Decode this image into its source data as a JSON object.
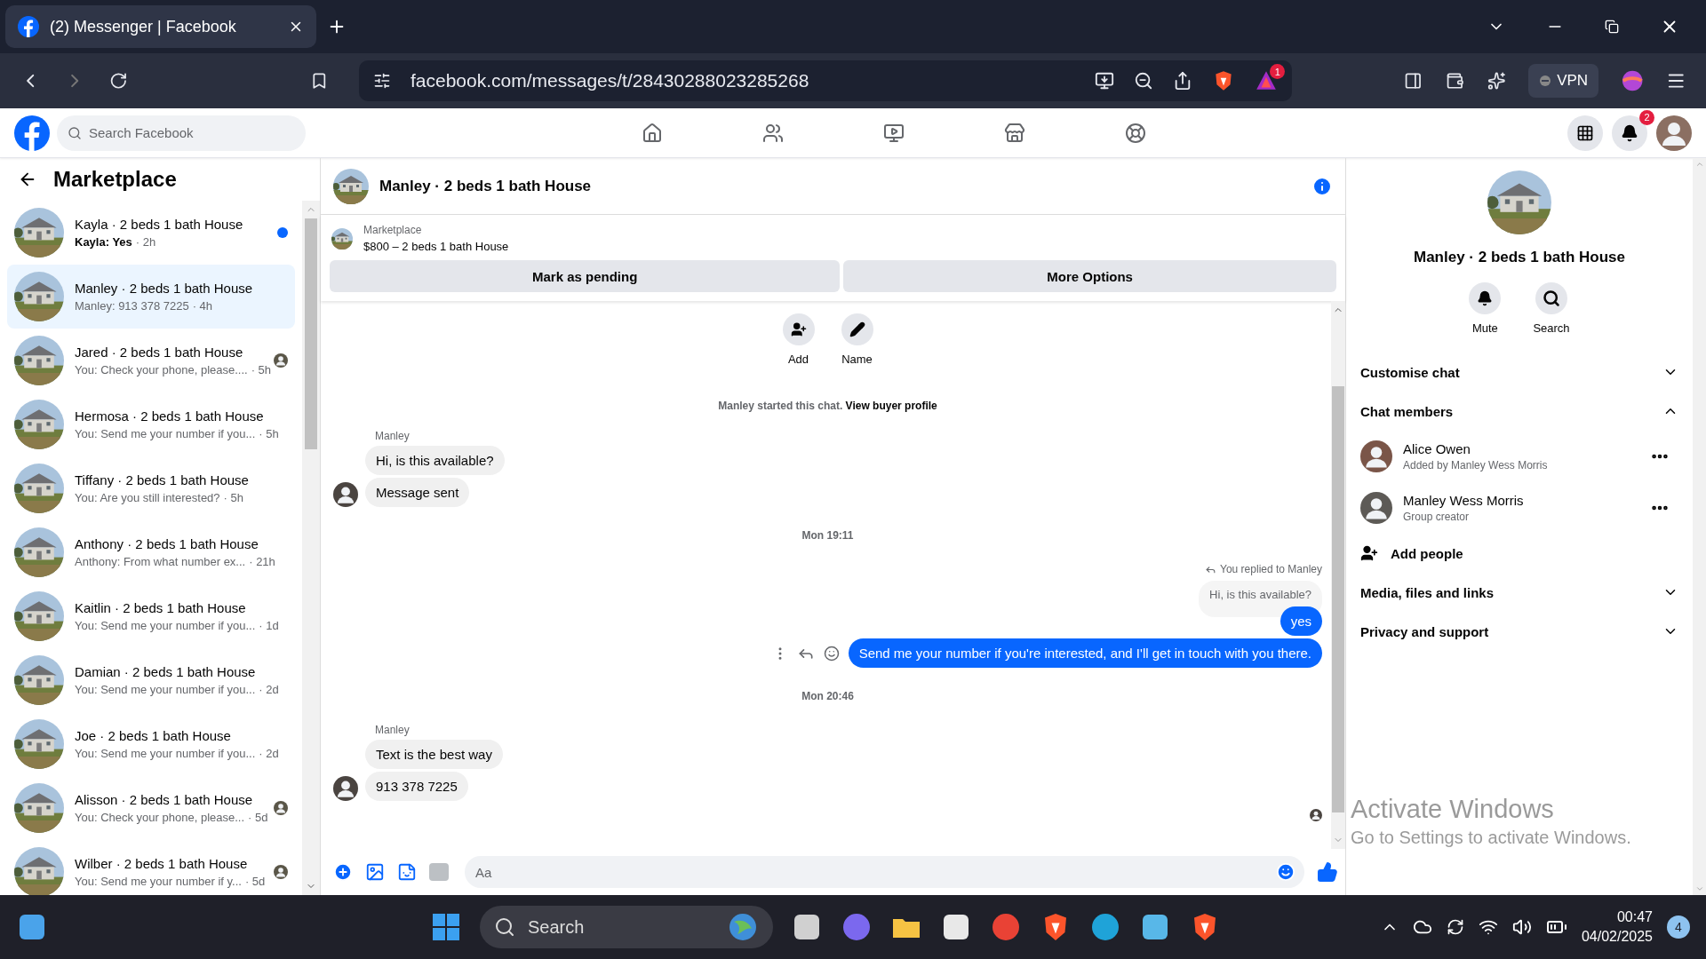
{
  "browser": {
    "tab_title": "(2) Messenger | Facebook",
    "url": "facebook.com/messages/t/28430288023285268",
    "alert_count": "1",
    "vpn_label": "VPN"
  },
  "facebook_header": {
    "search_placeholder": "Search Facebook",
    "notification_count": "2"
  },
  "sidebar": {
    "title": "Marketplace",
    "conversations": [
      {
        "name": "Kayla · 2 beds 1 bath House",
        "preview": "Kayla: Yes",
        "time": "· 2h",
        "selected": false,
        "unread": true,
        "seen": false
      },
      {
        "name": "Manley · 2 beds 1 bath House",
        "preview": "Manley: 913 378 7225",
        "time": "· 4h",
        "selected": true,
        "unread": false,
        "seen": false
      },
      {
        "name": "Jared · 2 beds 1 bath House",
        "preview": "You: Check your phone, please....",
        "time": "· 5h",
        "selected": false,
        "unread": false,
        "seen": true
      },
      {
        "name": "Hermosa · 2 beds 1 bath House",
        "preview": "You: Send me your number if you...",
        "time": "· 5h",
        "selected": false,
        "unread": false,
        "seen": false
      },
      {
        "name": "Tiffany · 2 beds 1 bath House",
        "preview": "You: Are you still interested?",
        "time": "· 5h",
        "selected": false,
        "unread": false,
        "seen": false
      },
      {
        "name": "Anthony · 2 beds 1 bath House",
        "preview": "Anthony: From what number ex...",
        "time": "· 21h",
        "selected": false,
        "unread": false,
        "seen": false
      },
      {
        "name": "Kaitlin · 2 beds 1 bath House",
        "preview": "You: Send me your number if you...",
        "time": "· 1d",
        "selected": false,
        "unread": false,
        "seen": false
      },
      {
        "name": "Damian · 2 beds 1 bath House",
        "preview": "You: Send me your number if you...",
        "time": "· 2d",
        "selected": false,
        "unread": false,
        "seen": false
      },
      {
        "name": "Joe · 2 beds 1 bath House",
        "preview": "You: Send me your number if you...",
        "time": "· 2d",
        "selected": false,
        "unread": false,
        "seen": false
      },
      {
        "name": "Alisson · 2 beds 1 bath House",
        "preview": "You: Check your phone, please...",
        "time": "· 5d",
        "selected": false,
        "unread": false,
        "seen": true
      },
      {
        "name": "Wilber · 2 beds 1 bath House",
        "preview": "You: Send me your number if y...",
        "time": "· 5d",
        "selected": false,
        "unread": false,
        "seen": true
      }
    ]
  },
  "chat": {
    "title": "Manley · 2 beds 1 bath House",
    "listing": {
      "label": "Marketplace",
      "title": "$800 – 2 beds 1 bath House"
    },
    "buttons": [
      "Mark as pending",
      "More Options"
    ],
    "actions": [
      {
        "kind": "add",
        "label": "Add"
      },
      {
        "kind": "name",
        "label": "Name"
      }
    ],
    "started": {
      "text": "Manley started this chat.",
      "link": "View buyer profile"
    },
    "messages": [
      {
        "kind": "sender",
        "text": "Manley"
      },
      {
        "kind": "incoming",
        "text": "Hi, is this available?",
        "avatar": false
      },
      {
        "kind": "incoming",
        "text": "Message sent",
        "avatar": true
      },
      {
        "kind": "time",
        "text": "Mon 19:11"
      },
      {
        "kind": "reply-note",
        "text": "You replied to Manley"
      },
      {
        "kind": "quoted",
        "text": "Hi, is this available?"
      },
      {
        "kind": "outgoing",
        "text": "yes",
        "tools": false
      },
      {
        "kind": "outgoing",
        "text": "Send me your number if you're interested, and I'll get in touch with you there.",
        "tools": true
      },
      {
        "kind": "time",
        "text": "Mon 20:46"
      },
      {
        "kind": "sender",
        "text": "Manley"
      },
      {
        "kind": "incoming",
        "text": "Text is the best way",
        "avatar": false
      },
      {
        "kind": "incoming",
        "text": "913 378 7225",
        "avatar": true
      },
      {
        "kind": "seen"
      }
    ],
    "composer": {
      "placeholder": "Aa"
    }
  },
  "details": {
    "title": "Manley · 2 beds 1 bath House",
    "actions": [
      {
        "kind": "mute",
        "label": "Mute"
      },
      {
        "kind": "search",
        "label": "Search"
      }
    ],
    "sections": [
      {
        "label": "Customise chat",
        "expanded": false
      },
      {
        "label": "Chat members",
        "expanded": true,
        "members": [
          {
            "name": "Alice Owen",
            "role": "Added by Manley Wess Morris"
          },
          {
            "name": "Manley Wess Morris",
            "role": "Group creator"
          }
        ],
        "add_label": "Add people"
      },
      {
        "label": "Media, files and links",
        "expanded": false
      },
      {
        "label": "Privacy and support",
        "expanded": false
      }
    ]
  },
  "taskbar": {
    "search": "Search",
    "time": "00:47",
    "date": "04/02/2025",
    "notification_count": "4"
  },
  "os_notice": {
    "title": "Activate Windows",
    "text": "Go to Settings to activate Windows."
  }
}
